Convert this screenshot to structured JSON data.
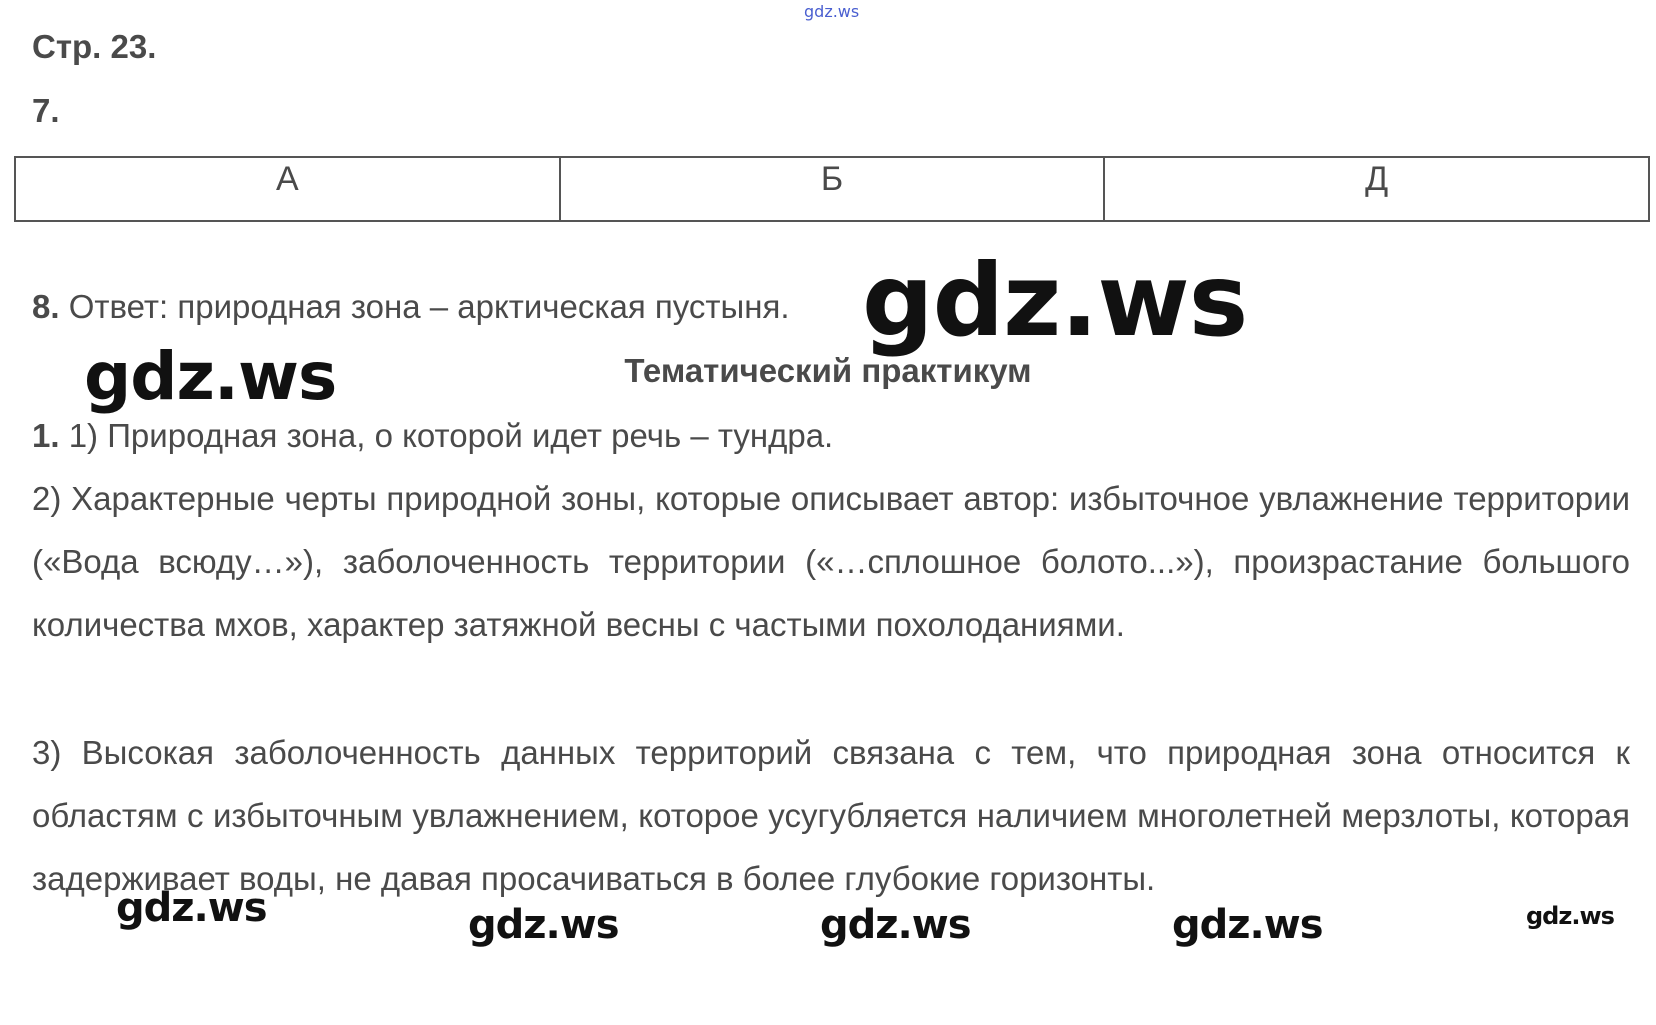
{
  "header": {
    "page_ref": "Стр. 23.",
    "task7_number": "7."
  },
  "table": {
    "cells": [
      "А",
      "Б",
      "Д"
    ]
  },
  "task8": {
    "number": "8.",
    "text": " Ответ: природная зона – арктическая пустыня."
  },
  "section": {
    "heading": "Тематический практикум"
  },
  "task1": {
    "number": "1.",
    "p1": " 1) Природная зона, о которой идет речь – тундра.",
    "p2": "2) Характерные черты природной зоны, которые описывает автор: избыточное увлажнение территории («Вода всюду…»), заболоченность территории («…сплошное болото...»), произрастание большого количества мхов, характер затяжной весны с частыми похолоданиями.",
    "p3": "3) Высокая заболоченность данных территорий связана с тем, что природная зона относится к областям с избыточным увлажнением, которое усугубляется наличием многолетней мерзлоты, которая задерживает воды, не давая просачиваться в более глубокие горизонты."
  },
  "watermarks": {
    "top": "gdz.ws",
    "big": "gdz.ws",
    "left": "gdz.ws",
    "b1": "gdz.ws",
    "b2": "gdz.ws",
    "b3": "gdz.ws",
    "b4": "gdz.ws",
    "b5": "gdz.ws"
  }
}
